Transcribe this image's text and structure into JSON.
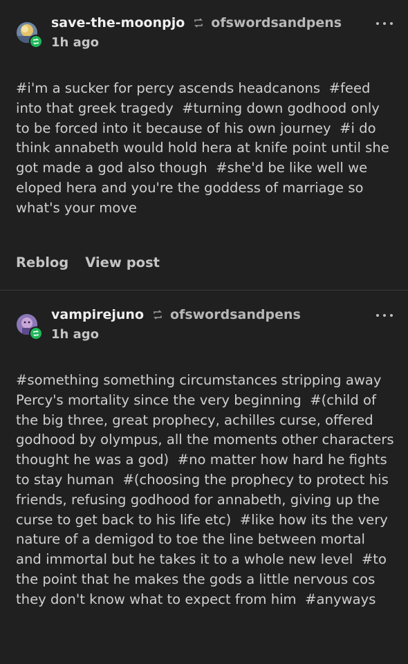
{
  "posts": [
    {
      "username": "save-the-moonpjo",
      "source": "ofswordsandpens",
      "time": "1h ago",
      "tags": [
        "#i'm a sucker for percy ascends headcanons",
        "#feed into that greek tragedy",
        "#turning down godhood only to be forced into it because of his own journey",
        "#i do think annabeth would hold hera at knife point until she got made a god also though",
        "#she'd be like well we eloped hera and you're the goddess of marriage so what's your move"
      ],
      "reblog_label": "Reblog",
      "view_post_label": "View post"
    },
    {
      "username": "vampirejuno",
      "source": "ofswordsandpens",
      "time": "1h ago",
      "tags": [
        "#something something circumstances stripping away Percy's mortality since the very beginning",
        "#(child of the big three, great prophecy, achilles curse, offered godhood by olympus, all the moments other characters thought he was a god)",
        "#no matter how hard he fights to stay human",
        "#(choosing the prophecy to protect his friends, refusing godhood for annabeth, giving up the curse to get back to his life etc)",
        "#like how its the very nature of a demigod to toe the line between mortal and immortal but he takes it to a whole new level",
        "#to the point that he makes the gods a little nervous cos they don't know what to expect from him",
        "#anyways"
      ]
    }
  ],
  "colors": {
    "background": "#202020",
    "reblog_badge": "#1fb85a",
    "divider": "#3a3a3a"
  }
}
